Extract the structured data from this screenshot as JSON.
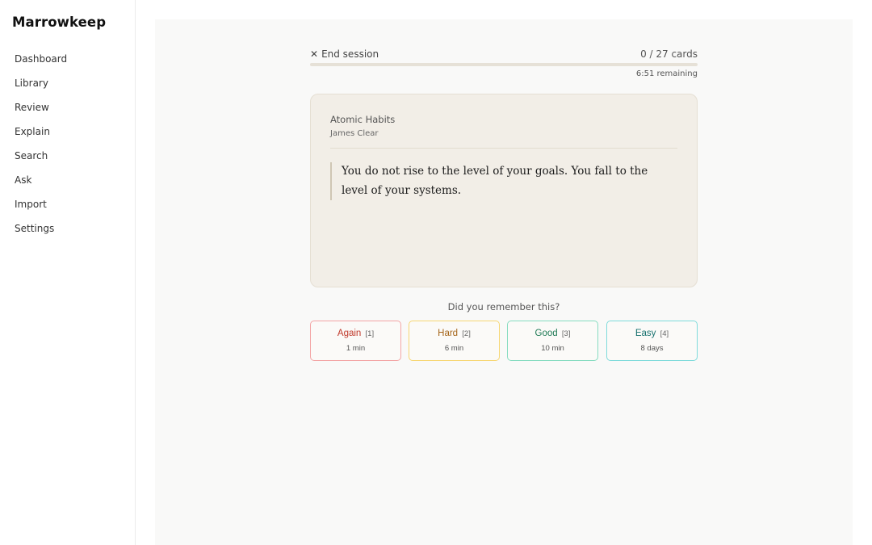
{
  "app": {
    "brand": "Marrowkeep"
  },
  "sidebar": {
    "items": [
      {
        "label": "Dashboard"
      },
      {
        "label": "Library"
      },
      {
        "label": "Review"
      },
      {
        "label": "Explain"
      },
      {
        "label": "Search"
      },
      {
        "label": "Ask"
      },
      {
        "label": "Import"
      },
      {
        "label": "Settings"
      }
    ]
  },
  "session": {
    "end_icon": "close-icon",
    "end_glyph": "✕",
    "end_label": "End session",
    "counter": "0 / 27 cards",
    "progress_fraction": 0,
    "remaining": "6:51 remaining"
  },
  "card": {
    "book_title": "Atomic Habits",
    "author": "James Clear",
    "quote": "You do not rise to the level of your goals. You fall to the level of your systems."
  },
  "review": {
    "prompt": "Did you remember this?",
    "options": [
      {
        "label": "Again",
        "key": "[1]",
        "interval": "1 min",
        "color": "#c0392b"
      },
      {
        "label": "Hard",
        "key": "[2]",
        "interval": "6 min",
        "color": "#a5651a"
      },
      {
        "label": "Good",
        "key": "[3]",
        "interval": "10 min",
        "color": "#1f7a55"
      },
      {
        "label": "Easy",
        "key": "[4]",
        "interval": "8 days",
        "color": "#17716f"
      }
    ]
  }
}
